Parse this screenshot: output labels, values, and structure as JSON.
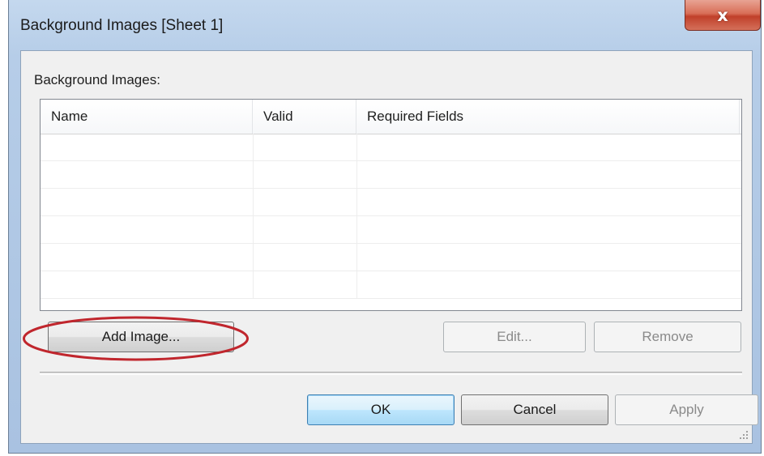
{
  "window": {
    "title": "Background Images [Sheet 1]",
    "close_glyph": "x"
  },
  "list": {
    "label": "Background Images:",
    "columns": [
      "Name",
      "Valid",
      "Required Fields"
    ],
    "rows": []
  },
  "buttons": {
    "add_image": "Add Image...",
    "edit": "Edit...",
    "remove": "Remove",
    "ok": "OK",
    "cancel": "Cancel",
    "apply": "Apply"
  },
  "icons": {
    "close": "close-icon",
    "resize_grip": "resize-grip-icon"
  },
  "colors": {
    "titlebar": "#b6cde8",
    "close_button": "#c0402a",
    "highlight_ellipse": "#c0262d",
    "default_button_border": "#3c7fb1"
  }
}
